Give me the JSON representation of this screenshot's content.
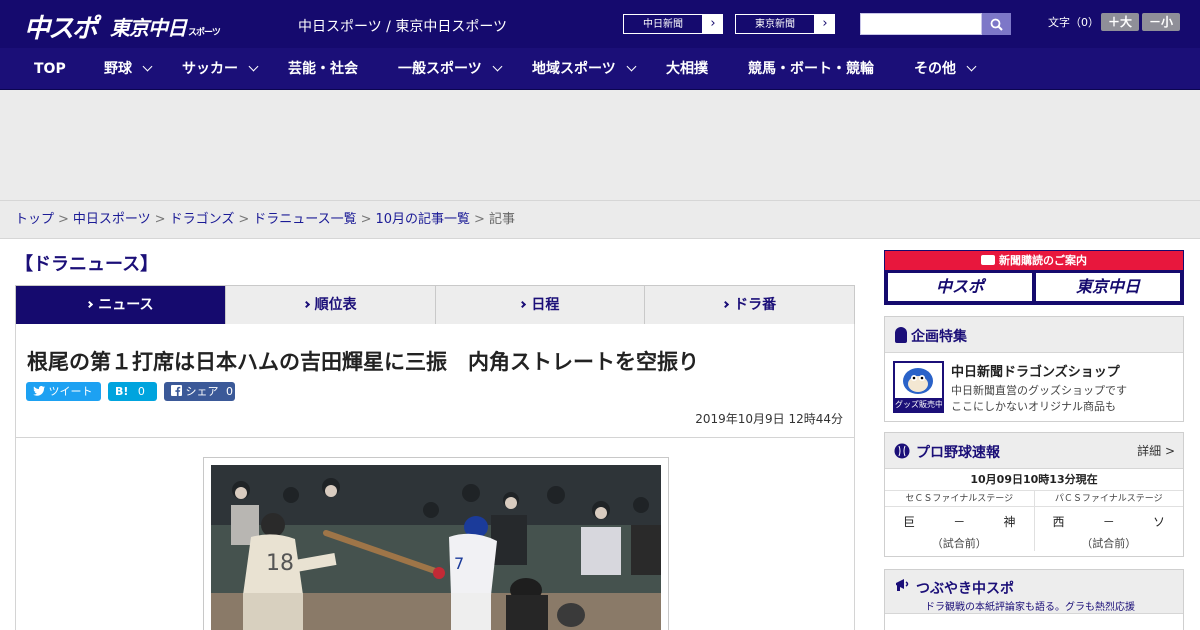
{
  "header": {
    "logo_main": "中スポ",
    "logo_tokyo": "東京中日",
    "logo_tokyo_small": "スポーツ",
    "site_label": "中日スポーツ / 東京中日スポーツ",
    "paper_links": [
      "中日新聞",
      "東京新聞"
    ],
    "search_placeholder": "",
    "font_size_label": "文字（0）",
    "font_larger": "＋大",
    "font_smaller": "－小"
  },
  "nav": [
    {
      "label": "TOP",
      "dropdown": false
    },
    {
      "label": "野球",
      "dropdown": true
    },
    {
      "label": "サッカー",
      "dropdown": true
    },
    {
      "label": "芸能・社会",
      "dropdown": false
    },
    {
      "label": "一般スポーツ",
      "dropdown": true
    },
    {
      "label": "地域スポーツ",
      "dropdown": true
    },
    {
      "label": "大相撲",
      "dropdown": false
    },
    {
      "label": "競馬・ボート・競輪",
      "dropdown": false
    },
    {
      "label": "その他",
      "dropdown": true
    }
  ],
  "breadcrumb": {
    "items": [
      "トップ",
      "中日スポーツ",
      "ドラゴンズ",
      "ドラニュース一覧",
      "10月の記事一覧"
    ],
    "current": "記事"
  },
  "section_title": "【ドラニュース】",
  "tabs": [
    "ニュース",
    "順位表",
    "日程",
    "ドラ番"
  ],
  "article": {
    "headline": "根尾の第１打席は日本ハムの吉田輝星に三振　内角ストレートを空振り",
    "share": {
      "tweet": "ツイート",
      "hatena": "B!",
      "hatena_count": "0",
      "facebook": "シェア",
      "facebook_count": "0"
    },
    "date": "2019年10月9日 12時44分"
  },
  "sidebar": {
    "subscription_head": "新聞購読のご案内",
    "subscription_logos": [
      "中スポ",
      "東京中日"
    ],
    "feature_title": "企画特集",
    "feature_item_title": "中日新聞ドラゴンズショップ",
    "feature_item_desc1": "中日新聞直営のグッズショップです",
    "feature_item_desc2": "ここにしかないオリジナル商品も",
    "feature_badge": "グッズ販売中",
    "scores_title": "プロ野球速報",
    "scores_more": "詳細 >",
    "scores_date": "10月09日10時13分現在",
    "games": [
      {
        "stage": "セＣＳファイナルステージ",
        "home": "巨",
        "sep": "－",
        "away": "神",
        "status": "（試合前）"
      },
      {
        "stage": "パＣＳファイナルステージ",
        "home": "西",
        "sep": "－",
        "away": "ソ",
        "status": "（試合前）"
      }
    ],
    "tweets_title": "つぶやき中スポ",
    "tweets_sub": "ドラ観戦の本紙評論家も語る。グラも熱烈応援"
  },
  "colors": {
    "navy": "#150a6e",
    "nav": "#1b0f78",
    "red": "#e8173d",
    "twitter": "#1da1f2",
    "hatena": "#00a4de",
    "facebook": "#3b5998"
  },
  "icons": [
    "search-icon",
    "chevron-right-icon",
    "chevron-down-icon",
    "twitter-icon",
    "facebook-icon",
    "ribbon-icon",
    "baseball-icon",
    "megaphone-icon",
    "newspaper-icon"
  ]
}
